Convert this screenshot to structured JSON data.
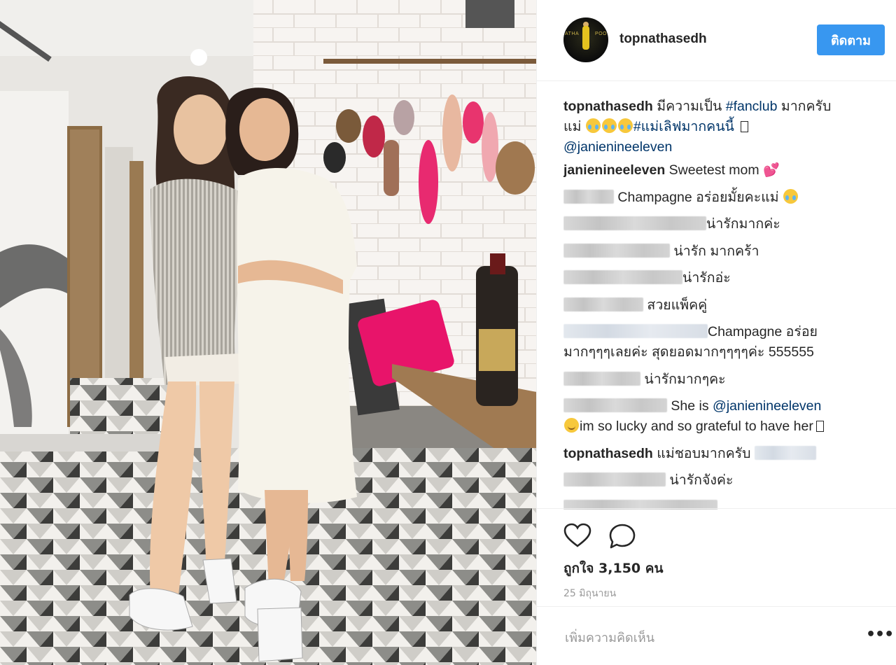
{
  "post": {
    "author": "topnathasedh",
    "follow_label": "ติดตาม",
    "caption": {
      "username": "topnathasedh",
      "text_1": "มีความเป็น",
      "tag_1": "#fanclub",
      "text_2": "มากครับ",
      "text_3": "แม่",
      "tag_2": "#แม่เลิฟมากคนนี้",
      "mention": "@janienineeleven"
    }
  },
  "comments": {
    "c1_user": "janienineeleven",
    "c1_text": "Sweetest mom",
    "c2_text": "Champagne อร่อยมั้ยคะแม่",
    "c3_text": "น่ารักมากค่ะ",
    "c4_text": "น่ารัก มากคร้า",
    "c5_text": "น่ารักอ่ะ",
    "c6_text": "สวยแพ็คคู่",
    "c7_text_1": "Champagne อร่อย",
    "c7_text_2": "มากๆๆๆเลยค่ะ สุดยอดมากๆๆๆๆค่ะ 555555",
    "c8_text": "น่ารักมากๆคะ",
    "c9_text": "She is",
    "c9_mention": "@janienineeleven",
    "c9_text_2": "im so lucky and so grateful to have her",
    "c10_user": "topnathasedh",
    "c10_text": "แม่ชอบมากครับ",
    "c11_text": "น่ารักจังค่ะ"
  },
  "likes": "ถูกใจ 3,150 คน",
  "date": "25 มิถุนายน",
  "add_comment_placeholder": "เพิ่มความคิดเห็น",
  "more_label": "•••",
  "icons": {
    "like": "heart-icon",
    "comment": "comment-bubble-icon",
    "more": "more-options-icon"
  },
  "colors": {
    "follow_button": "#3897f0",
    "link": "#003569",
    "accent_pink_cushion": "#e8146a"
  }
}
